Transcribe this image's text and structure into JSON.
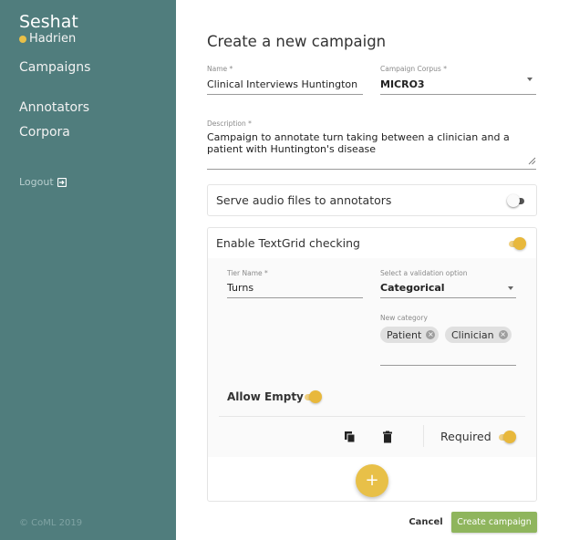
{
  "app": {
    "brand": "Seshat",
    "user": "Hadrien",
    "accent": "#e8c048",
    "sidebar_color": "#507d7d"
  },
  "sidebar": {
    "nav": [
      {
        "label": "Campaigns"
      },
      {
        "label": "Annotators"
      },
      {
        "label": "Corpora"
      }
    ],
    "logout_label": "Logout",
    "logout_icon": "logout-icon",
    "copyright": "© CoML 2019"
  },
  "form": {
    "title": "Create a new campaign",
    "name": {
      "label": "Name *",
      "value": "Clinical Interviews Huntington"
    },
    "corpus": {
      "label": "Campaign Corpus *",
      "value": "MICRO3"
    },
    "description": {
      "label": "Description *",
      "value": "Campaign to annotate turn taking between a clinician and a patient with Huntington's disease"
    },
    "serve_audio": {
      "label": "Serve audio files to annotators",
      "enabled": false
    },
    "textgrid": {
      "label": "Enable TextGrid checking",
      "enabled": true,
      "tier": {
        "name_label": "Tier Name *",
        "name_value": "Turns",
        "validation_label": "Select a validation option",
        "validation_value": "Categorical",
        "new_category_label": "New category",
        "categories": [
          "Patient",
          "Clinician"
        ],
        "allow_empty_label": "Allow Empty",
        "allow_empty": true,
        "required_label": "Required",
        "required": true
      },
      "add_tier_symbol": "+"
    },
    "cancel_label": "Cancel",
    "create_label": "Create campaign",
    "create_color": "#8fb55d"
  }
}
